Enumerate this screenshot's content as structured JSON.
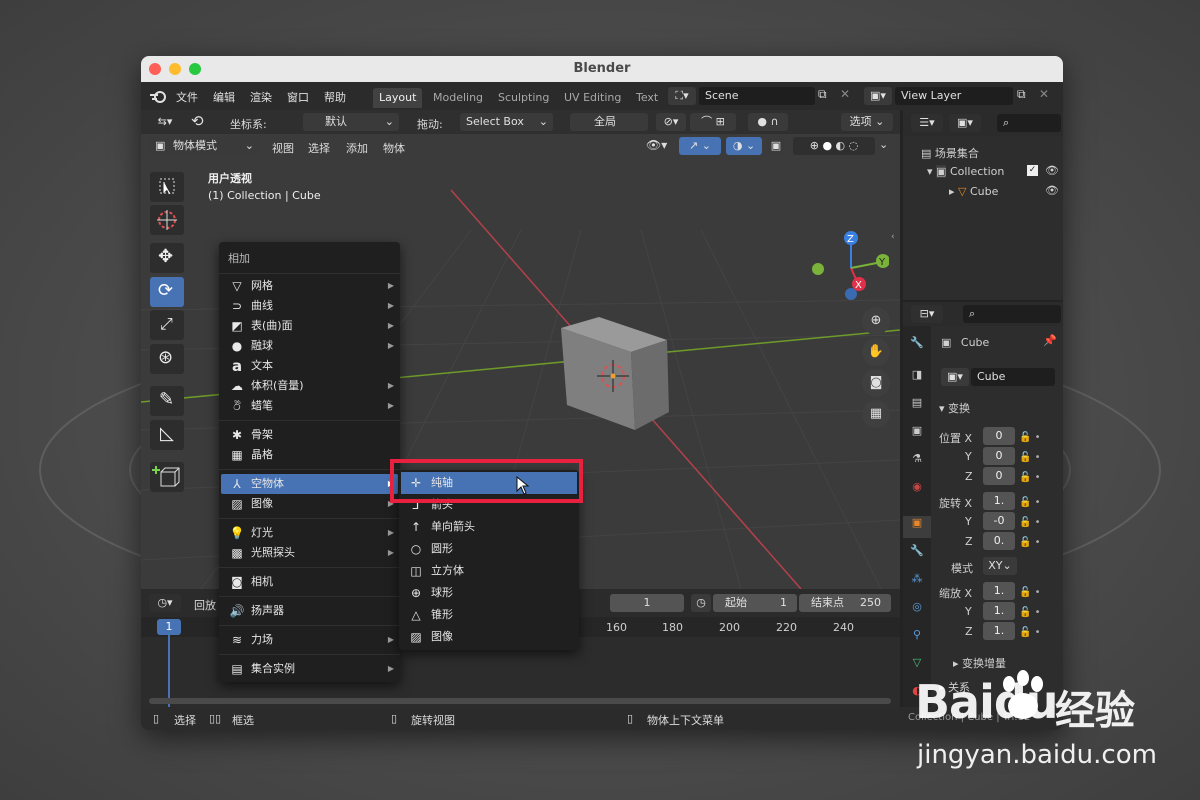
{
  "window": {
    "title": "Blender"
  },
  "menubar": {
    "items": [
      "文件",
      "编辑",
      "渲染",
      "窗口",
      "帮助"
    ]
  },
  "workspaces": [
    "Layout",
    "Modeling",
    "Sculpting",
    "UV Editing",
    "Text"
  ],
  "scene": {
    "name": "Scene"
  },
  "view_layer": {
    "name": "View Layer"
  },
  "viewport_header": {
    "coord_label": "坐标系:",
    "coord_value": "默认",
    "drag_label": "拖动:",
    "drag_value": "Select Box",
    "pivot_value": "全局",
    "options": "选项",
    "mode": "物体模式",
    "menus": [
      "视图",
      "选择",
      "添加",
      "物体"
    ]
  },
  "viewport": {
    "view_name": "用户透视",
    "collection_info": "(1) Collection | Cube"
  },
  "gizmo": {
    "z": "Z",
    "x": "X",
    "y": "Y"
  },
  "add_menu": {
    "title": "相加",
    "items": [
      {
        "icon": "mesh-icon",
        "label": "网格"
      },
      {
        "icon": "curve-icon",
        "label": "曲线"
      },
      {
        "icon": "surface-icon",
        "label": "表(曲)面"
      },
      {
        "icon": "metaball-icon",
        "label": "融球"
      },
      {
        "icon": "text-icon",
        "label": "文本"
      },
      {
        "icon": "volume-icon",
        "label": "体积(音量)"
      },
      {
        "icon": "grease-pencil-icon",
        "label": "蜡笔"
      },
      {
        "icon": "armature-icon",
        "label": "骨架"
      },
      {
        "icon": "lattice-icon",
        "label": "晶格"
      },
      {
        "icon": "empty-icon",
        "label": "空物体"
      },
      {
        "icon": "image-icon",
        "label": "图像"
      },
      {
        "icon": "light-icon",
        "label": "灯光"
      },
      {
        "icon": "light-probe-icon",
        "label": "光照探头"
      },
      {
        "icon": "camera-icon",
        "label": "相机"
      },
      {
        "icon": "speaker-icon",
        "label": "扬声器"
      },
      {
        "icon": "force-field-icon",
        "label": "力场"
      },
      {
        "icon": "collection-instance-icon",
        "label": "集合实例"
      }
    ]
  },
  "empty_submenu": {
    "items": [
      {
        "icon": "plain-axes-icon",
        "label": "纯轴"
      },
      {
        "icon": "arrows-icon",
        "label": "箭头"
      },
      {
        "icon": "single-arrow-icon",
        "label": "单向箭头"
      },
      {
        "icon": "circle-icon",
        "label": "圆形"
      },
      {
        "icon": "cube-icon",
        "label": "立方体"
      },
      {
        "icon": "sphere-icon",
        "label": "球形"
      },
      {
        "icon": "cone-icon",
        "label": "锥形"
      },
      {
        "icon": "image-icon",
        "label": "图像"
      }
    ]
  },
  "timeline": {
    "playback": "回放",
    "current_frame": "1",
    "start_label": "起始",
    "start_value": "1",
    "end_label": "结束点",
    "end_value": "250",
    "ruler": [
      "1",
      "160",
      "180",
      "200",
      "220",
      "240"
    ]
  },
  "outliner": {
    "root": "场景集合",
    "collection": "Collection",
    "object": "Cube"
  },
  "properties": {
    "object_name": "Cube",
    "data_name": "Cube",
    "transform_title": "变换",
    "location_label": "位置 X",
    "rotation_label": "旋转 X",
    "scale_label": "缩放 X",
    "y_label": "Y",
    "z_label": "Z",
    "loc": [
      "0",
      "0",
      "0"
    ],
    "rot": [
      "1.",
      "-0",
      "0."
    ],
    "scale": [
      "1.",
      "1.",
      "1."
    ],
    "mode_label": "模式",
    "mode_value": "XY",
    "delta_transform": "变换增量",
    "relations": "关系"
  },
  "statusbar": {
    "select": "选择",
    "box_select": "框选",
    "rotate_view": "旋转视图",
    "context_menu": "物体上下文菜单",
    "info": "Collection | Cube | Tri:12"
  },
  "watermark": {
    "brand": "Baidu",
    "site_cn": "经验",
    "url": "jingyan.baidu.com"
  },
  "colors": {
    "accent": "#4772b3",
    "highlight_box": "#e8213f"
  }
}
